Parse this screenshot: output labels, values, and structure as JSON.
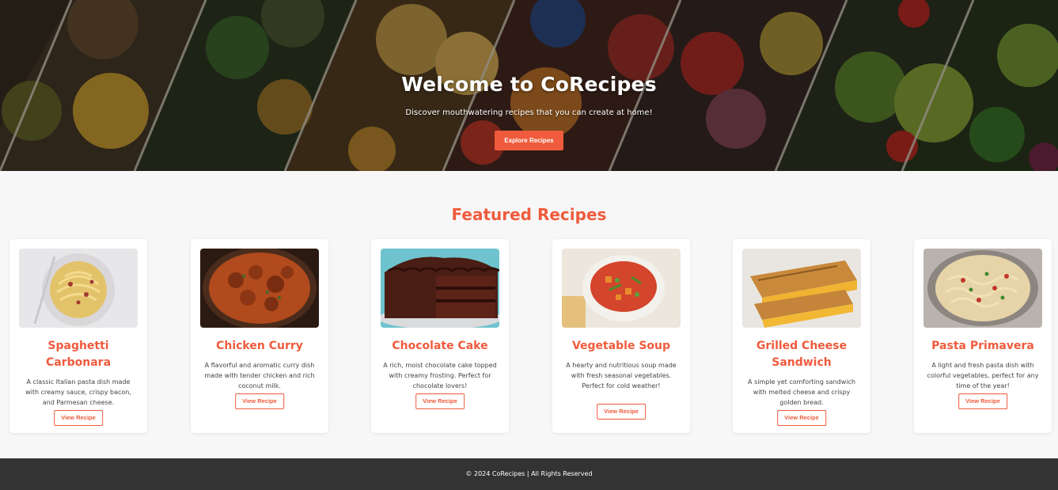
{
  "hero": {
    "title": "Welcome to CoRecipes",
    "subtitle": "Discover mouthwatering recipes that you can create at home!",
    "button_label": "Explore Recipes"
  },
  "featured": {
    "title": "Featured Recipes",
    "recipes": [
      {
        "title": "Spaghetti Carbonara",
        "description": "A classic Italian pasta dish made with creamy sauce, crispy bacon, and Parmesan cheese.",
        "button_label": "View Recipe",
        "image": "spaghetti-carbonara-photo"
      },
      {
        "title": "Chicken Curry",
        "description": "A flavorful and aromatic curry dish made with tender chicken and rich coconut milk.",
        "button_label": "View Recipe",
        "image": "chicken-curry-photo"
      },
      {
        "title": "Chocolate Cake",
        "description": "A rich, moist chocolate cake topped with creamy frosting. Perfect for chocolate lovers!",
        "button_label": "View Recipe",
        "image": "chocolate-cake-photo"
      },
      {
        "title": "Vegetable Soup",
        "description": "A hearty and nutritious soup made with fresh seasonal vegetables. Perfect for cold weather!",
        "button_label": "View Recipe",
        "image": "vegetable-soup-photo"
      },
      {
        "title": "Grilled Cheese Sandwich",
        "description": "A simple yet comforting sandwich with melted cheese and crispy golden bread.",
        "button_label": "View Recipe",
        "image": "grilled-cheese-photo"
      },
      {
        "title": "Pasta Primavera",
        "description": "A light and fresh pasta dish with colorful vegetables, perfect for any time of the year!",
        "button_label": "View Recipe",
        "image": "pasta-primavera-photo"
      }
    ]
  },
  "footer": {
    "text": "© 2024 CoRecipes | All Rights Reserved"
  },
  "colors": {
    "accent": "#ef5b3c",
    "footer_bg": "#333333",
    "page_bg": "#f7f7f7"
  }
}
